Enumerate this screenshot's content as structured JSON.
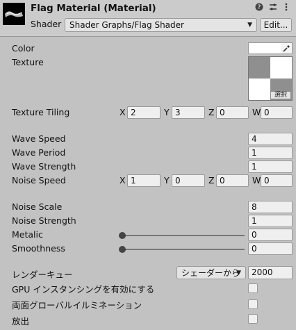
{
  "header": {
    "title": "Flag Material (Material)",
    "shader_label": "Shader",
    "shader_value": "Shader Graphs/Flag Shader",
    "edit_label": "Edit..."
  },
  "properties": {
    "color_label": "Color",
    "color_value": "#ffffff",
    "texture_label": "Texture",
    "texture_select": "選択",
    "tiling_label": "Texture Tiling",
    "tiling": {
      "x": "2",
      "y": "3",
      "z": "0",
      "w": "0"
    },
    "wave_speed_label": "Wave Speed",
    "wave_speed": "4",
    "wave_period_label": "Wave Period",
    "wave_period": "1",
    "wave_strength_label": "Wave Strength",
    "wave_strength": "1",
    "noise_speed_label": "Noise Speed",
    "noise_speed": {
      "x": "1",
      "y": "0",
      "z": "0",
      "w": "0"
    },
    "noise_scale_label": "Noise Scale",
    "noise_scale": "8",
    "noise_strength_label": "Noise Strength",
    "noise_strength": "1",
    "metalic_label": "Metalic",
    "metalic": "0",
    "smoothness_label": "Smoothness",
    "smoothness": "0"
  },
  "axis_labels": {
    "x": "X",
    "y": "Y",
    "z": "Z",
    "w": "W"
  },
  "render": {
    "queue_label": "レンダーキュー",
    "queue_mode": "シェーダーから",
    "queue_value": "2000",
    "gpu_instancing_label": "GPU インスタンシングを有効にする",
    "double_sided_gi_label": "両面グローバルイルミネーション",
    "emission_label": "放出"
  },
  "icons": {
    "help": "help-icon",
    "presets": "presets-icon",
    "more": "more-icon",
    "eyedropper": "eyedropper-icon"
  }
}
